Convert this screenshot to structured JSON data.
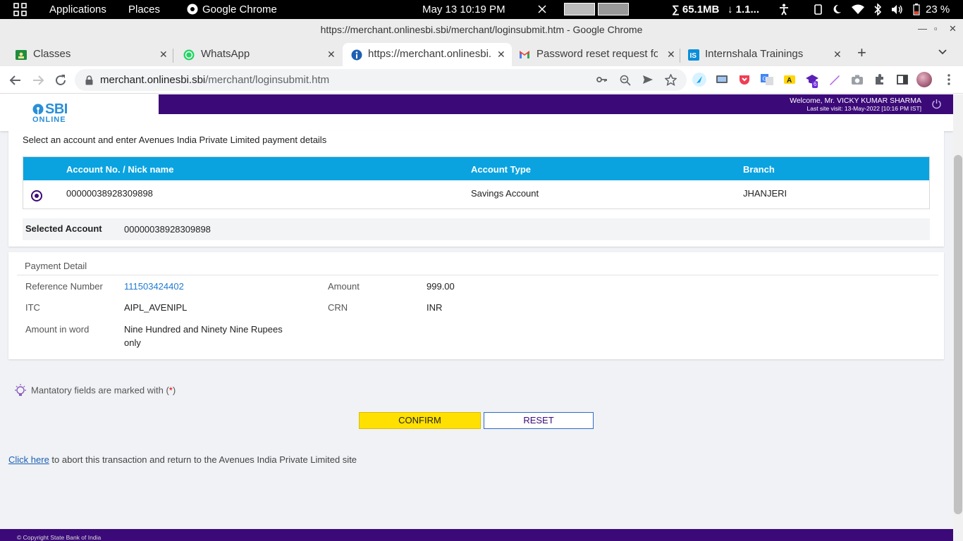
{
  "topbar": {
    "applications": "Applications",
    "places": "Places",
    "browser": "Google Chrome",
    "clock": "May 13  10:19 PM",
    "memory": "∑ 65.1MB",
    "network": "↓ 1.1...",
    "battery": "23 %"
  },
  "window": {
    "title": "https://merchant.onlinesbi.sbi/merchant/loginsubmit.htm - Google Chrome"
  },
  "tabs": [
    {
      "label": "Classes"
    },
    {
      "label": "WhatsApp"
    },
    {
      "label": "https://merchant.onlinesbi.sbi/merchant/loginsubmit.htm"
    },
    {
      "label": "Password reset request fo"
    },
    {
      "label": "Internshala Trainings"
    }
  ],
  "address": {
    "host": "merchant.onlinesbi.sbi",
    "path": "/merchant/loginsubmit.htm"
  },
  "extensions": {
    "badge": "6"
  },
  "header": {
    "logo_top": "SBI",
    "logo_bottom": "ONLINE",
    "welcome": "Welcome, Mr. VICKY KUMAR SHARMA",
    "last_visit": "Last site visit: 13-May-2022 [10:16 PM IST]"
  },
  "account_section": {
    "intro": "Select an account and enter Avenues India Private Limited payment details",
    "columns": [
      "Account No. / Nick name",
      "Account Type",
      "Branch"
    ],
    "row": {
      "account_no": "00000038928309898",
      "type": "Savings Account",
      "branch": "JHANJERI"
    },
    "selected_label": "Selected Account",
    "selected_value": "00000038928309898"
  },
  "payment": {
    "heading": "Payment Detail",
    "reference_label": "Reference Number",
    "reference_value": "111503424402",
    "amount_label": "Amount",
    "amount_value": "999.00",
    "itc_label": "ITC",
    "itc_value": "AIPL_AVENIPL",
    "crn_label": "CRN",
    "crn_value": "INR",
    "words_label": "Amount in word",
    "words_value_line1": "Nine Hundred and Ninety Nine Rupees",
    "words_value_line2": "only"
  },
  "form": {
    "mandatory_text": "Mantatory fields are marked with (",
    "mandatory_star": "*",
    "mandatory_close": ")",
    "confirm": "CONFIRM",
    "reset": "RESET",
    "abort_link": "Click here",
    "abort_text": " to abort this transaction and return to the Avenues India Private Limited site"
  },
  "footer": {
    "copyright": "© Copyright State Bank of India"
  },
  "colors": {
    "brand_purple": "#3b0a78",
    "table_header": "#0aa3e0",
    "confirm_yellow": "#ffe000",
    "sbi_blue": "#2a8fd8"
  }
}
